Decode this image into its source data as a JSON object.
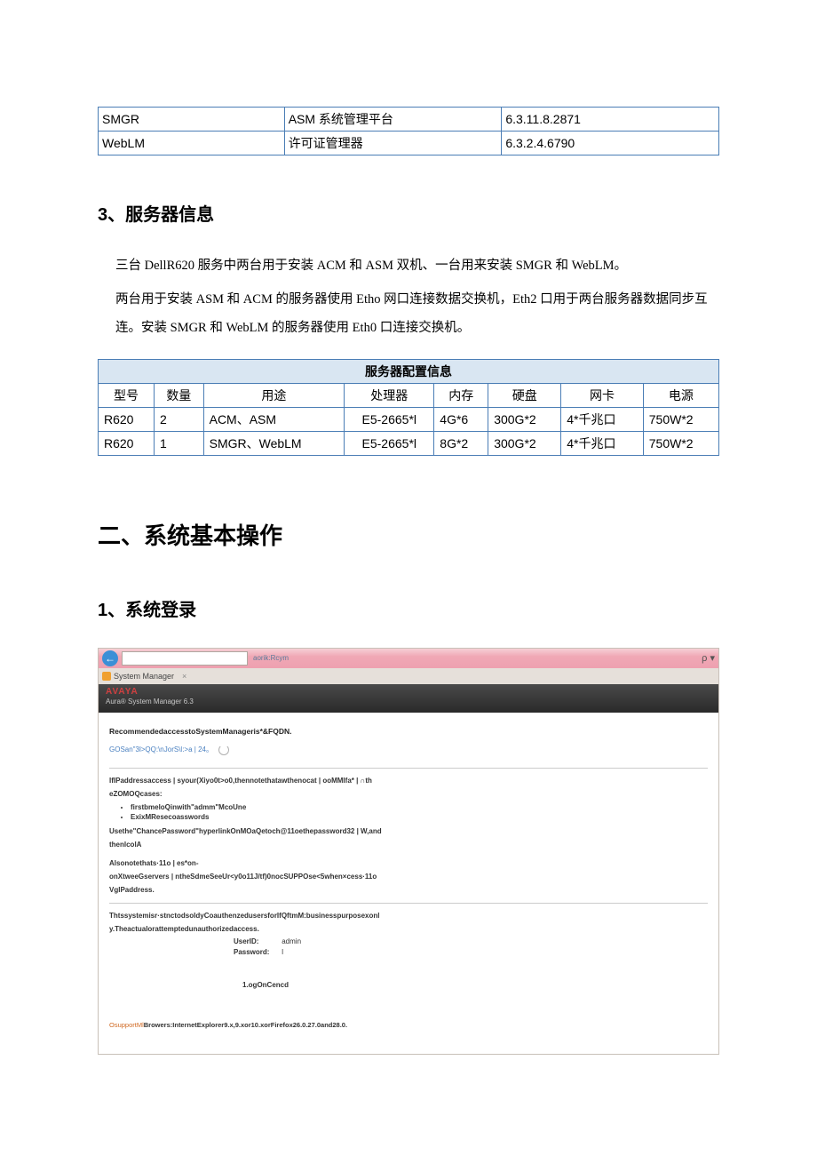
{
  "softwareTable": {
    "rows": [
      {
        "name": "SMGR",
        "desc": "ASM 系统管理平台",
        "ver": "6.3.11.8.2871"
      },
      {
        "name": "WebLM",
        "desc": "许可证管理器",
        "ver": "6.3.2.4.6790"
      }
    ]
  },
  "section3": {
    "heading": "3、服务器信息",
    "p1": "三台 DellR620 服务中两台用于安装 ACM 和 ASM 双机、一台用来安装 SMGR 和 WebLM。",
    "p2": "两台用于安装 ASM 和 ACM 的服务器使用 Etho 网口连接数据交换机，Eth2 口用于两台服务器数据同步互连。安装 SMGR 和 WebLM 的服务器使用 Eth0 口连接交换机。"
  },
  "serverTable": {
    "title": "服务器配置信息",
    "headers": {
      "model": "型号",
      "qty": "数量",
      "use": "用途",
      "cpu": "处理器",
      "mem": "内存",
      "disk": "硬盘",
      "nic": "网卡",
      "psu": "电源"
    },
    "rows": [
      {
        "model": "R620",
        "qty": "2",
        "use": "ACM、ASM",
        "cpu": "E5-2665*l",
        "mem": "4G*6",
        "disk": "300G*2",
        "nic": "4*千兆口",
        "psu": "750W*2"
      },
      {
        "model": "R620",
        "qty": "1",
        "use": "SMGR、WebLM",
        "cpu": "E5-2665*l",
        "mem": "8G*2",
        "disk": "300G*2",
        "nic": "4*千兆口",
        "psu": "750W*2"
      }
    ]
  },
  "chapter2": {
    "title": "二、系统基本操作"
  },
  "section_login": {
    "heading": "1、系统登录"
  },
  "screenshot": {
    "addrSeg": "aorik:Rcym",
    "searchGlyph": "ρ ▾",
    "tabTitle": "System Manager",
    "tabClose": "×",
    "logo": "AVAYA",
    "bannerSub": "Aura® System Manager 6.3",
    "recLine": "RecommendedaccesstoSystemManageris*&FQDN.",
    "linkLine": "GOSan\"3l>QQ:\\nJorS\\l:>a | 24。",
    "ipLine": "IfIPaddressaccess | syour(Xiyo0t>o0,thennotethatawthenocat | ooMMIfa* | ∩th",
    "ezomoq": "eZOMOQcases:",
    "bullet1": "firstbmeloQinwith\"admm\"McoUne",
    "bullet2": "ExixMResecoasswords",
    "useLine": "Usethe\"ChancePassword\"hyperlinkOnMOaQetoch@11oethepassword32 | W,and",
    "thenLine": "thenlcolA",
    "alsoLine": "Alsonotethats·11o | es*on-",
    "onxLine": "onXtweeGservers | ntheSdmeSeeUr<y0o11J/tf)0nocSUPPOse<5when×cess·11o",
    "vgipLine": "VgIPaddress.",
    "thtsLine": "Thtssystemisr·stnctodsoldyCoauthenzedusersforIfQftmM:businesspurposexonl",
    "yLine": "y.Theactualorattemptedunauthorizedaccess.",
    "userIdLabel": "UserID:",
    "userIdVal": "admin",
    "passwordLabel": "Password:",
    "passwordVal": "l",
    "loginBtn": "1.ogOnCencd",
    "footerOrange": "OsupportMl",
    "footerRest": "Browers:InternetExplorer9.x,9.xor10.xorFirefox26.0.27.0and28.0."
  }
}
